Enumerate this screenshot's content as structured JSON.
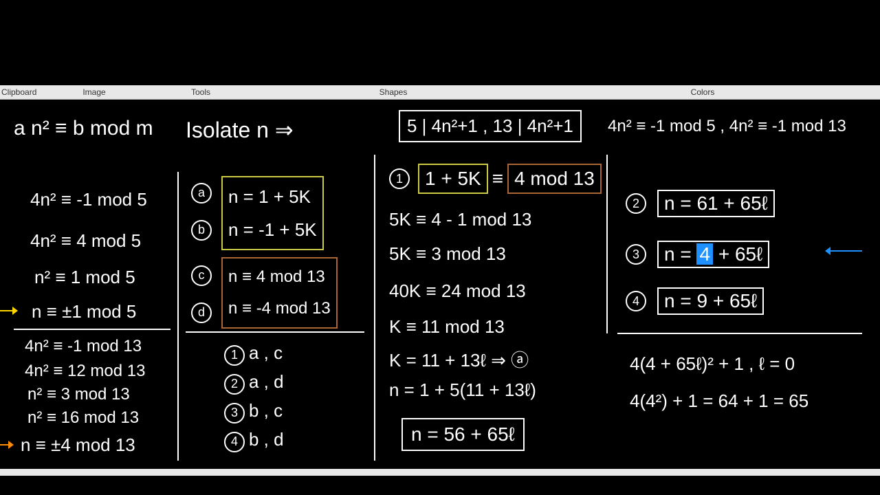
{
  "toolbar": {
    "clipboard": "Clipboard",
    "image": "Image",
    "tools": "Tools",
    "shapes": "Shapes",
    "colors": "Colors"
  },
  "top": {
    "general": "a n² ≡ b mod m",
    "isolate": "Isolate n  ⇒",
    "divis": "5 | 4n²+1  ,  13 | 4n²+1",
    "cong": "4n² ≡ -1 mod 5  ,  4n² ≡ -1 mod 13"
  },
  "col1": {
    "l1": "4n² ≡ -1 mod 5",
    "l2": "4n² ≡ 4 mod 5",
    "l3": "n² ≡ 1 mod 5",
    "l4": "n ≡ ±1 mod 5",
    "l5": "4n² ≡ -1 mod 13",
    "l6": "4n² ≡ 12 mod 13",
    "l7": "n² ≡ 3 mod 13",
    "l8": "n² ≡ 16 mod 13",
    "l9": "n ≡ ±4 mod 13"
  },
  "col2": {
    "a": "n = 1 + 5K",
    "b": "n = -1 + 5K",
    "c": "n ≡ 4 mod 13",
    "d": "n ≡ -4 mod 13",
    "p1": "a  ,  c",
    "p2": "a  ,  d",
    "p3": "b  ,  c",
    "p4": "b  ,  d"
  },
  "col3": {
    "eqL": "1 + 5K",
    "eqM": "≡",
    "eqR": "4 mod 13",
    "s1": "5K ≡ 4 - 1 mod 13",
    "s2": "5K ≡ 3 mod 13",
    "s3": "40K ≡ 24 mod 13",
    "s4": "K ≡ 11 mod 13",
    "s5": "K = 11 + 13ℓ ⇒  ⓐ",
    "s6": "n = 1 + 5(11 + 13ℓ)",
    "res": "n = 56 + 65ℓ"
  },
  "col4": {
    "r2": "n = 61 + 65ℓ",
    "r3a": "n = ",
    "r3b": "4",
    "r3c": " + 65ℓ",
    "r4": "n = 9 + 65ℓ",
    "chk1": "4(4 + 65ℓ)² + 1  ,  ℓ = 0",
    "chk2": "4(4²) + 1 = 64 + 1 = 65"
  }
}
